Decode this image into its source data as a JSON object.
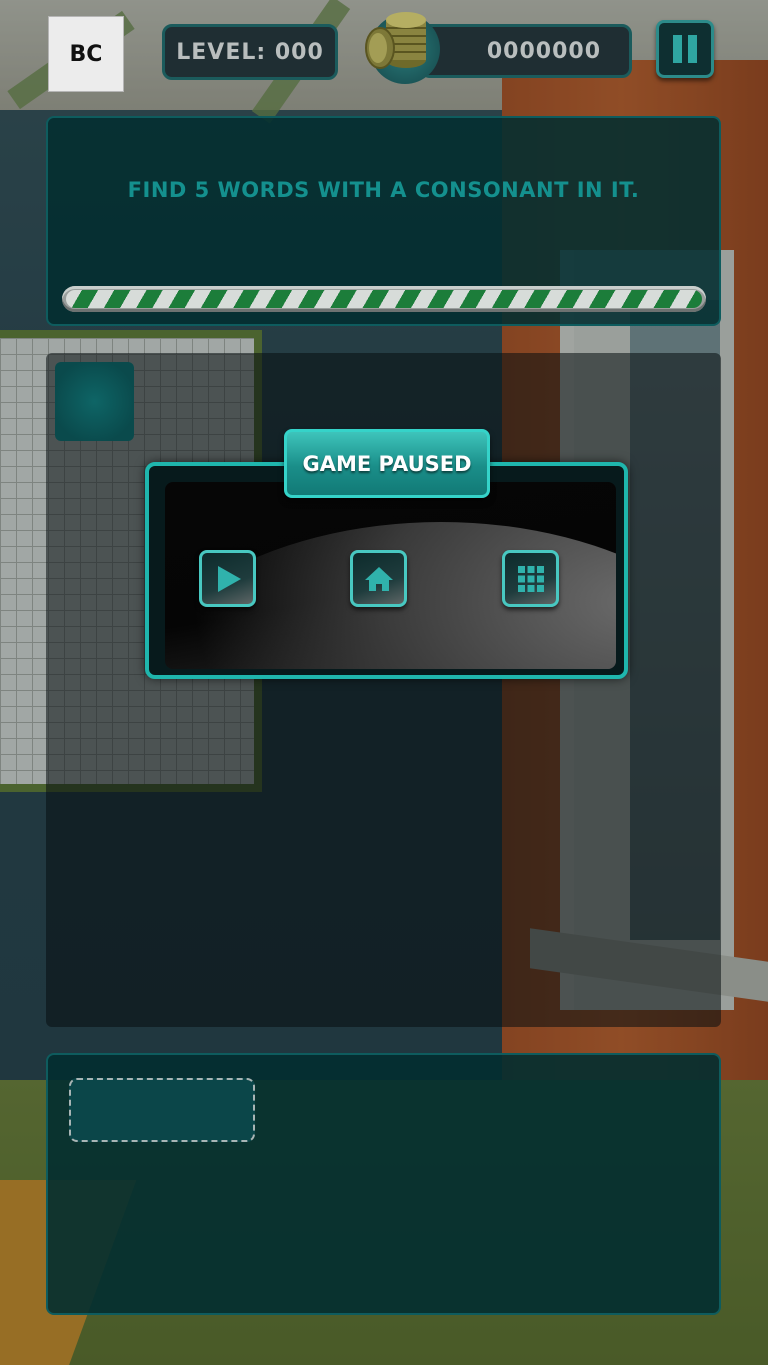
{
  "header": {
    "logo_text": "BC",
    "level_text": "LEVEL: 000",
    "coins_text": "0000000",
    "coin_icon": "coin-stack-icon",
    "pause_icon": "pause-icon"
  },
  "task": {
    "text": "FIND 5 WORDS WITH A CONSONANT IN IT.",
    "progress": 1.0
  },
  "pause_dialog": {
    "title": "GAME PAUSED",
    "buttons": [
      {
        "icon": "play-icon"
      },
      {
        "icon": "home-icon"
      },
      {
        "icon": "level-grid-icon"
      }
    ]
  },
  "colors": {
    "accent": "#1fb6ad",
    "panel": "#022d30",
    "task_text": "#14908e",
    "progress_stripe": "#1c7d3a"
  }
}
